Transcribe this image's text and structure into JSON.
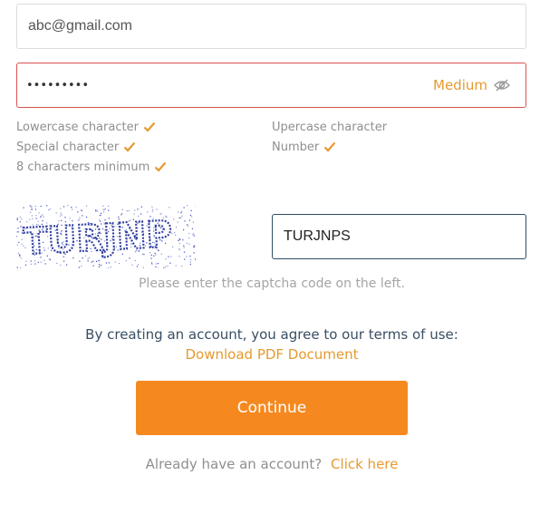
{
  "email": {
    "value": "abc@gmail.com"
  },
  "password": {
    "masked_value": "•••••••••",
    "strength_label": "Medium",
    "toggle_icon": "eye-slash-icon"
  },
  "requirements": [
    {
      "label": "Lowercase character",
      "met": true
    },
    {
      "label": "Upercase character",
      "met": false
    },
    {
      "label": "Special character",
      "met": true
    },
    {
      "label": "Number",
      "met": true
    },
    {
      "label": "8 characters minimum",
      "met": true
    }
  ],
  "captcha": {
    "image_text": "TURJNP",
    "input_value": "TURJNPS",
    "hint": "Please enter the captcha code on the left."
  },
  "terms": {
    "text": "By creating an account, you agree to our terms of use:",
    "link": "Download PDF Document"
  },
  "continue_label": "Continue",
  "login": {
    "prompt": "Already have an account?",
    "link": "Click here"
  },
  "colors": {
    "accent": "#f5891f",
    "check": "#e59a30",
    "error_border": "#d9534f",
    "captcha_text": "#2f3d9e"
  }
}
